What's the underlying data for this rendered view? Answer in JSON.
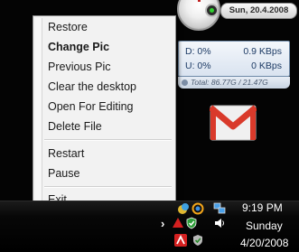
{
  "clock_gadget": {
    "date": "Sun, 20.4.2008"
  },
  "net_meter": {
    "download_label": "D: 0%",
    "download_rate": "0.9 KBps",
    "upload_label": "U: 0%",
    "upload_rate": "0 KBps",
    "total": "Total: 86.77G / 21.47G"
  },
  "context_menu": {
    "items": [
      {
        "label": "Restore"
      },
      {
        "label": "Change Pic"
      },
      {
        "label": "Previous Pic"
      },
      {
        "label": "Clear the desktop"
      },
      {
        "label": "Open For Editing"
      },
      {
        "label": "Delete File"
      },
      {
        "label": "Restart"
      },
      {
        "label": "Pause"
      },
      {
        "label": "Exit"
      }
    ]
  },
  "taskbar": {
    "time": "9:19 PM",
    "day": "Sunday",
    "date": "4/20/2008",
    "colors": {
      "antivirus_red": "#d42020",
      "volume_white": "#ffffff",
      "network_blue": "#4aa0e8"
    }
  }
}
